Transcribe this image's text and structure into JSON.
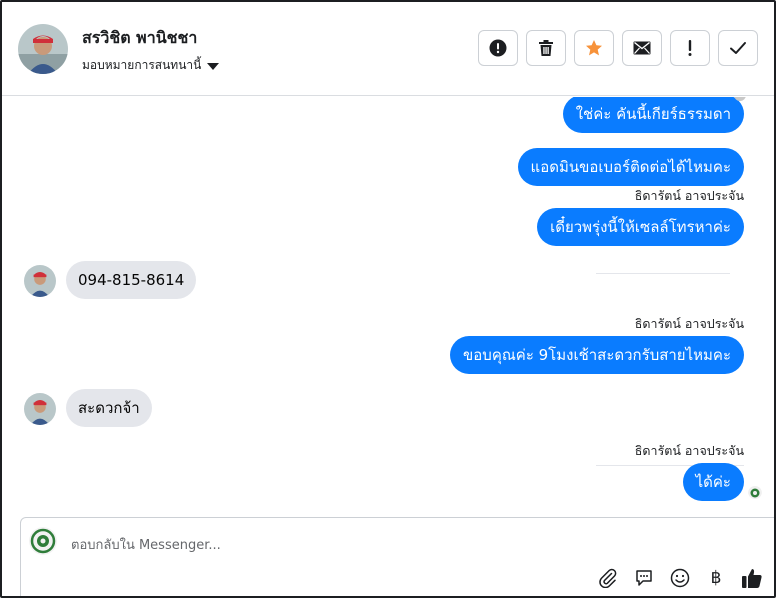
{
  "header": {
    "contact_name": "สรวิชิต พานิชชา",
    "assign_label": "มอบหมายการสนทนานี้"
  },
  "actions": [
    {
      "icon": "alert-circle-icon"
    },
    {
      "icon": "trash-icon"
    },
    {
      "icon": "star-icon",
      "color": "#f7923a"
    },
    {
      "icon": "envelope-icon"
    },
    {
      "icon": "exclamation-icon"
    },
    {
      "icon": "check-icon"
    }
  ],
  "messages": [
    {
      "side": "out",
      "text": "ใช่ค่ะ คันนี้เกียร์ธรรมดา"
    },
    {
      "side": "out",
      "text": "แอดมินขอเบอร์ติดต่อได้ไหมคะ"
    },
    {
      "side": "out",
      "sender": "ธิดารัตน์ อาจประจัน",
      "text": "เดี๋ยวพรุ่งนี้ให้เซลล์โทรหาค่ะ"
    },
    {
      "side": "in",
      "text": "094-815-8614"
    },
    {
      "side": "out",
      "sender": "ธิดารัตน์ อาจประจัน",
      "text": "ขอบคุณค่ะ 9โมงเช้าสะดวกรับสายไหมคะ"
    },
    {
      "side": "in",
      "text": "สะดวกจ้า"
    },
    {
      "side": "out",
      "sender": "ธิดารัตน์ อาจประจัน",
      "text": "ได้ค่ะ"
    }
  ],
  "composer": {
    "placeholder": "ตอบกลับใน Messenger..."
  },
  "tools": [
    {
      "icon": "paperclip-icon"
    },
    {
      "icon": "saved-reply-icon"
    },
    {
      "icon": "emoji-icon"
    },
    {
      "icon": "baht-payment-icon",
      "glyph": "฿"
    },
    {
      "icon": "thumbs-up-icon"
    }
  ],
  "colors": {
    "outgoing_bubble": "#0a7cff",
    "incoming_bubble": "#e4e6eb",
    "star": "#f7923a"
  }
}
